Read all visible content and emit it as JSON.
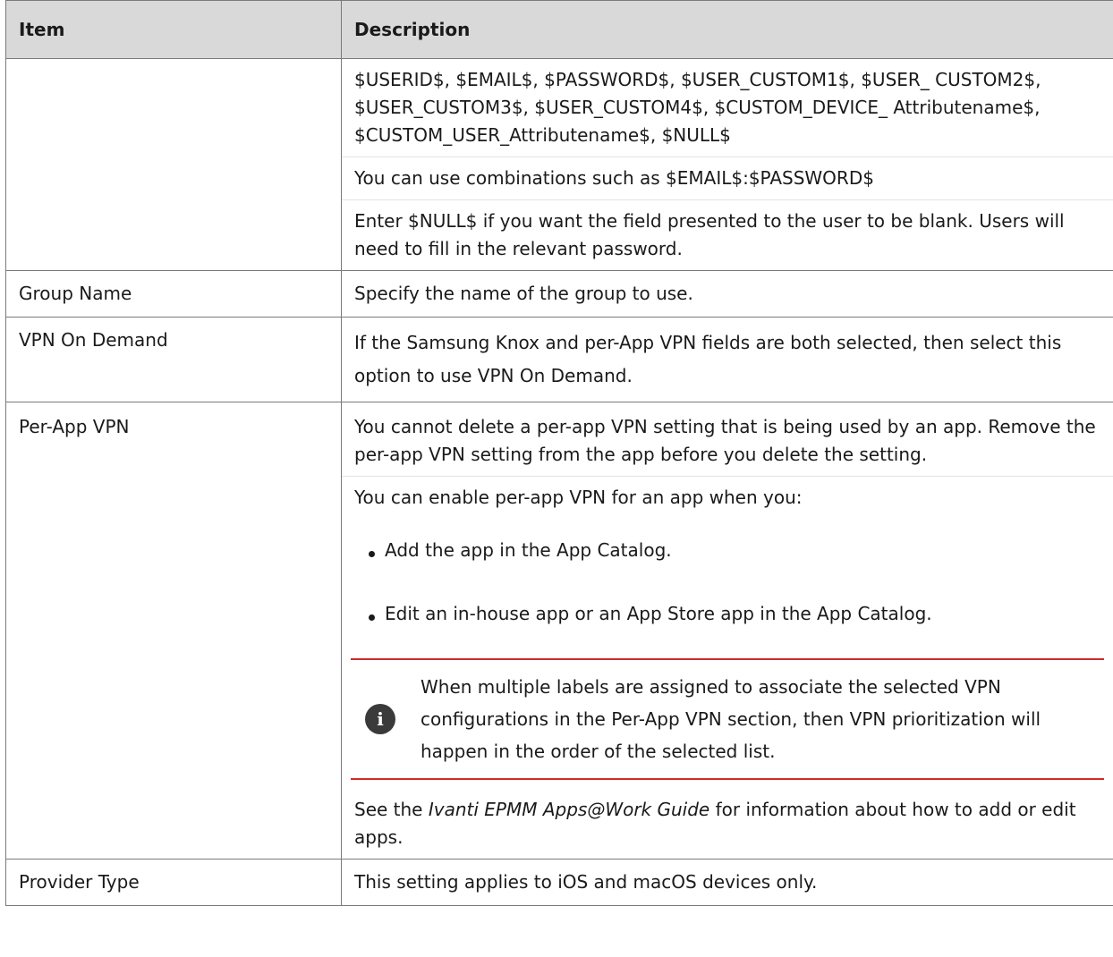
{
  "header": {
    "item": "Item",
    "description": "Description"
  },
  "rows": [
    {
      "item": "",
      "paras": [
        "$USERID$, $EMAIL$, $PASSWORD$, $USER_CUSTOM1$, $USER_ CUSTOM2$, $USER_CUSTOM3$, $USER_CUSTOM4$, $CUSTOM_DEVICE_ Attributename$, $CUSTOM_USER_Attributename$, $NULL$",
        "You can use combinations such as $EMAIL$:$PASSWORD$",
        "Enter $NULL$ if you want the field presented to the user to be blank. Users will need to fill in the relevant password."
      ]
    },
    {
      "item": "Group Name",
      "paras": [
        "Specify the name of the group to use."
      ]
    },
    {
      "item": "VPN On Demand",
      "paras": [
        "If the Samsung Knox and per-App VPN fields are both selected, then select this option to use VPN On Demand."
      ]
    },
    {
      "item": "Per-App VPN",
      "paras": [
        "You cannot delete a per-app VPN setting that is being used by an app. Remove the per-app VPN setting from the app before you delete the setting.",
        "You can enable per-app VPN for an app when you:"
      ],
      "bullets": [
        "Add the app in the App Catalog.",
        "Edit an in-house app or an App Store app in the App Catalog."
      ],
      "note": "When multiple labels are assigned to associate the selected VPN configurations in the Per-App VPN section, then VPN prioritization will happen in the order of the selected list.",
      "see_prefix": "See the ",
      "see_title": "Ivanti EPMM Apps@Work Guide",
      "see_suffix": " for information about how to add or edit apps."
    },
    {
      "item": "Provider Type",
      "paras": [
        "This setting applies to iOS and macOS devices only."
      ]
    }
  ]
}
